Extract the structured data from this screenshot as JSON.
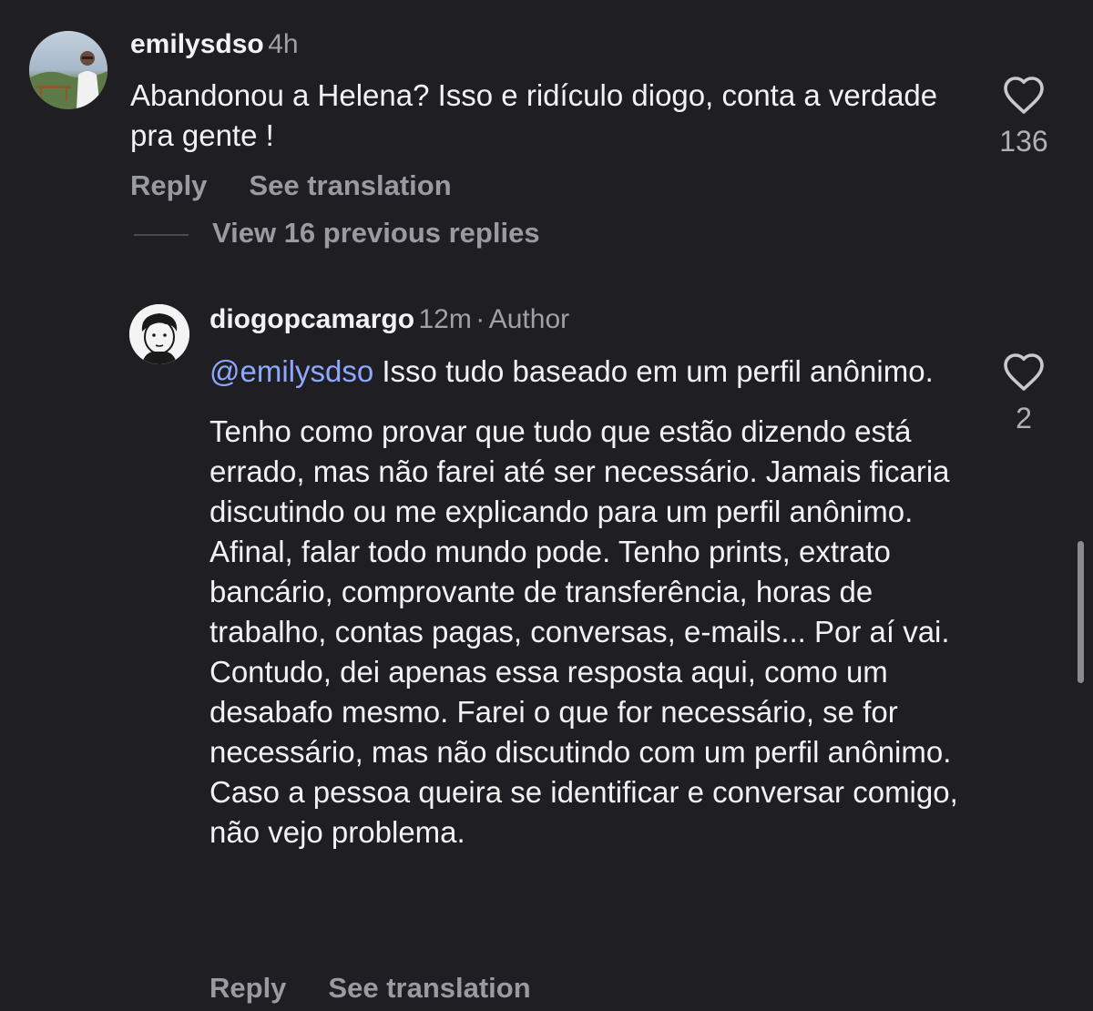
{
  "comment": {
    "username": "emilysdso",
    "time": "4h",
    "text": "Abandonou a Helena? Isso e ridículo diogo, conta a verdade pra gente !",
    "likes": "136",
    "reply_label": "Reply",
    "translate_label": "See translation"
  },
  "view_replies_label": "View 16 previous replies",
  "reply": {
    "username": "diogopcamargo",
    "time": "12m",
    "separator": "·",
    "badge": "Author",
    "mention": "@emilysdso",
    "text_line1": " Isso tudo baseado em um perfil anônimo.",
    "text_para2": "Tenho como provar que tudo que estão dizendo está errado, mas não farei até ser necessário. Jamais ficaria discutindo ou me explicando para um perfil anônimo. Afinal, falar todo mundo pode. Tenho prints, extrato bancário, comprovante de transferência, horas de trabalho, contas pagas, conversas, e-mails... Por aí vai. Contudo, dei apenas essa resposta aqui, como um desabafo mesmo. Farei o que for necessário, se for necessário, mas não discutindo com um perfil anônimo. Caso a pessoa queira se identificar e conversar comigo, não vejo problema.",
    "likes": "2",
    "reply_label": "Reply",
    "translate_label": "See translation"
  },
  "icons": {
    "like": "heart-outline-icon"
  },
  "colors": {
    "background": "#1f1f23",
    "mention": "#8fa8ff",
    "muted": "#9a9aa2"
  }
}
